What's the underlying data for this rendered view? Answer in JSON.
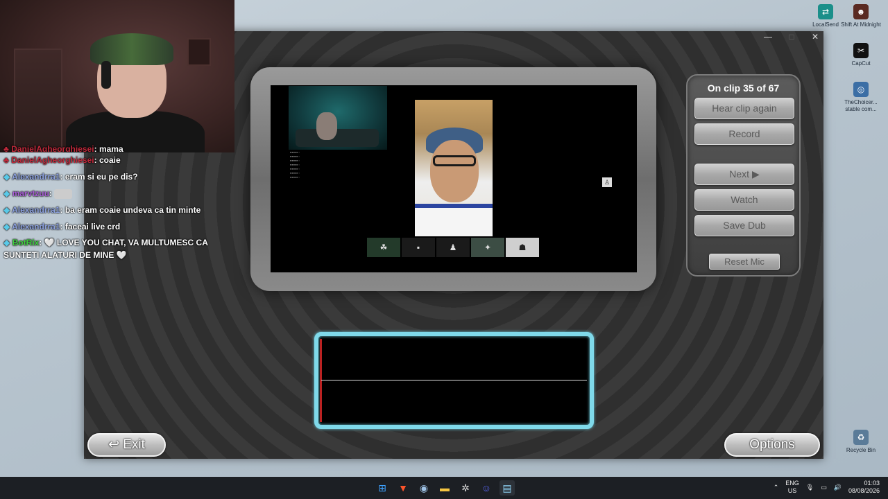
{
  "desktop": {
    "icons": [
      {
        "label": "LocalSend",
        "icon": "localsend-icon",
        "color": "#1b8f8a",
        "glyph": "⇄"
      },
      {
        "label": "Shift At Midnight",
        "icon": "game-icon",
        "color": "#5a2a22",
        "glyph": "☻"
      },
      {
        "label": "CapCut",
        "icon": "capcut-icon",
        "color": "#111111",
        "glyph": "✂"
      },
      {
        "label": "TheChoicer... stable com...",
        "icon": "app-icon",
        "color": "#3b6ea5",
        "glyph": "◎"
      },
      {
        "label": "Recycle Bin",
        "icon": "recycle-bin-icon",
        "color": "#5a7b98",
        "glyph": "♻"
      }
    ]
  },
  "chat": {
    "messages": [
      {
        "user": "DanielAgheorghiesei",
        "user_color": "#c0293b",
        "badge": "♣",
        "text": "mama"
      },
      {
        "user": "DanielAgheorghiesei",
        "user_color": "#c0293b",
        "badge": "♣",
        "text": "coaie"
      },
      {
        "user": "Alexandrra1",
        "user_color": "#8ea3e0",
        "badge": "◆",
        "text": "eram si eu pe dis?"
      },
      {
        "user": "marvtzuu",
        "user_color": "#a85fd6",
        "badge": "◆",
        "text": ""
      },
      {
        "user": "Alexandrra1",
        "user_color": "#8ea3e0",
        "badge": "◆",
        "text": "ba eram coaie undeva ca tin minte"
      },
      {
        "user": "Alexandrra1",
        "user_color": "#8ea3e0",
        "badge": "◆",
        "text": "faceai live crd"
      },
      {
        "user": "BotRix",
        "user_color": "#3fd13f",
        "badge": "◆",
        "text": "🤍 LOVE YOU CHAT, VA MULTUMESC CA SUNTETI ALATURI DE MINE 🤍"
      }
    ]
  },
  "app": {
    "window_controls": {
      "minimize": "—",
      "maximize": "□",
      "close": "✕"
    },
    "panel": {
      "clip_status": "On clip 35 of 67",
      "hear_again": "Hear clip again",
      "record": "Record",
      "next": "Next ▶",
      "watch": "Watch",
      "save_dub": "Save Dub",
      "reset_mic": "Reset Mic"
    },
    "exit_label": "↩ Exit",
    "options_label": "Options"
  },
  "taskbar": {
    "apps": [
      {
        "name": "start-icon",
        "glyph": "⊞",
        "color": "#3ea2ff"
      },
      {
        "name": "brave-icon",
        "glyph": "▼",
        "color": "#fb542b"
      },
      {
        "name": "steam-icon",
        "glyph": "◉",
        "color": "#9fc3e6"
      },
      {
        "name": "file-explorer-icon",
        "glyph": "▬",
        "color": "#f5c542"
      },
      {
        "name": "chatgpt-icon",
        "glyph": "✲",
        "color": "#e0e0e0"
      },
      {
        "name": "discord-icon",
        "glyph": "☺",
        "color": "#5865f2"
      },
      {
        "name": "notepad-icon",
        "glyph": "▤",
        "color": "#8fd3f5"
      }
    ],
    "lang_top": "ENG",
    "lang_bottom": "US",
    "time": "01:03",
    "date": "08/08/2026"
  }
}
